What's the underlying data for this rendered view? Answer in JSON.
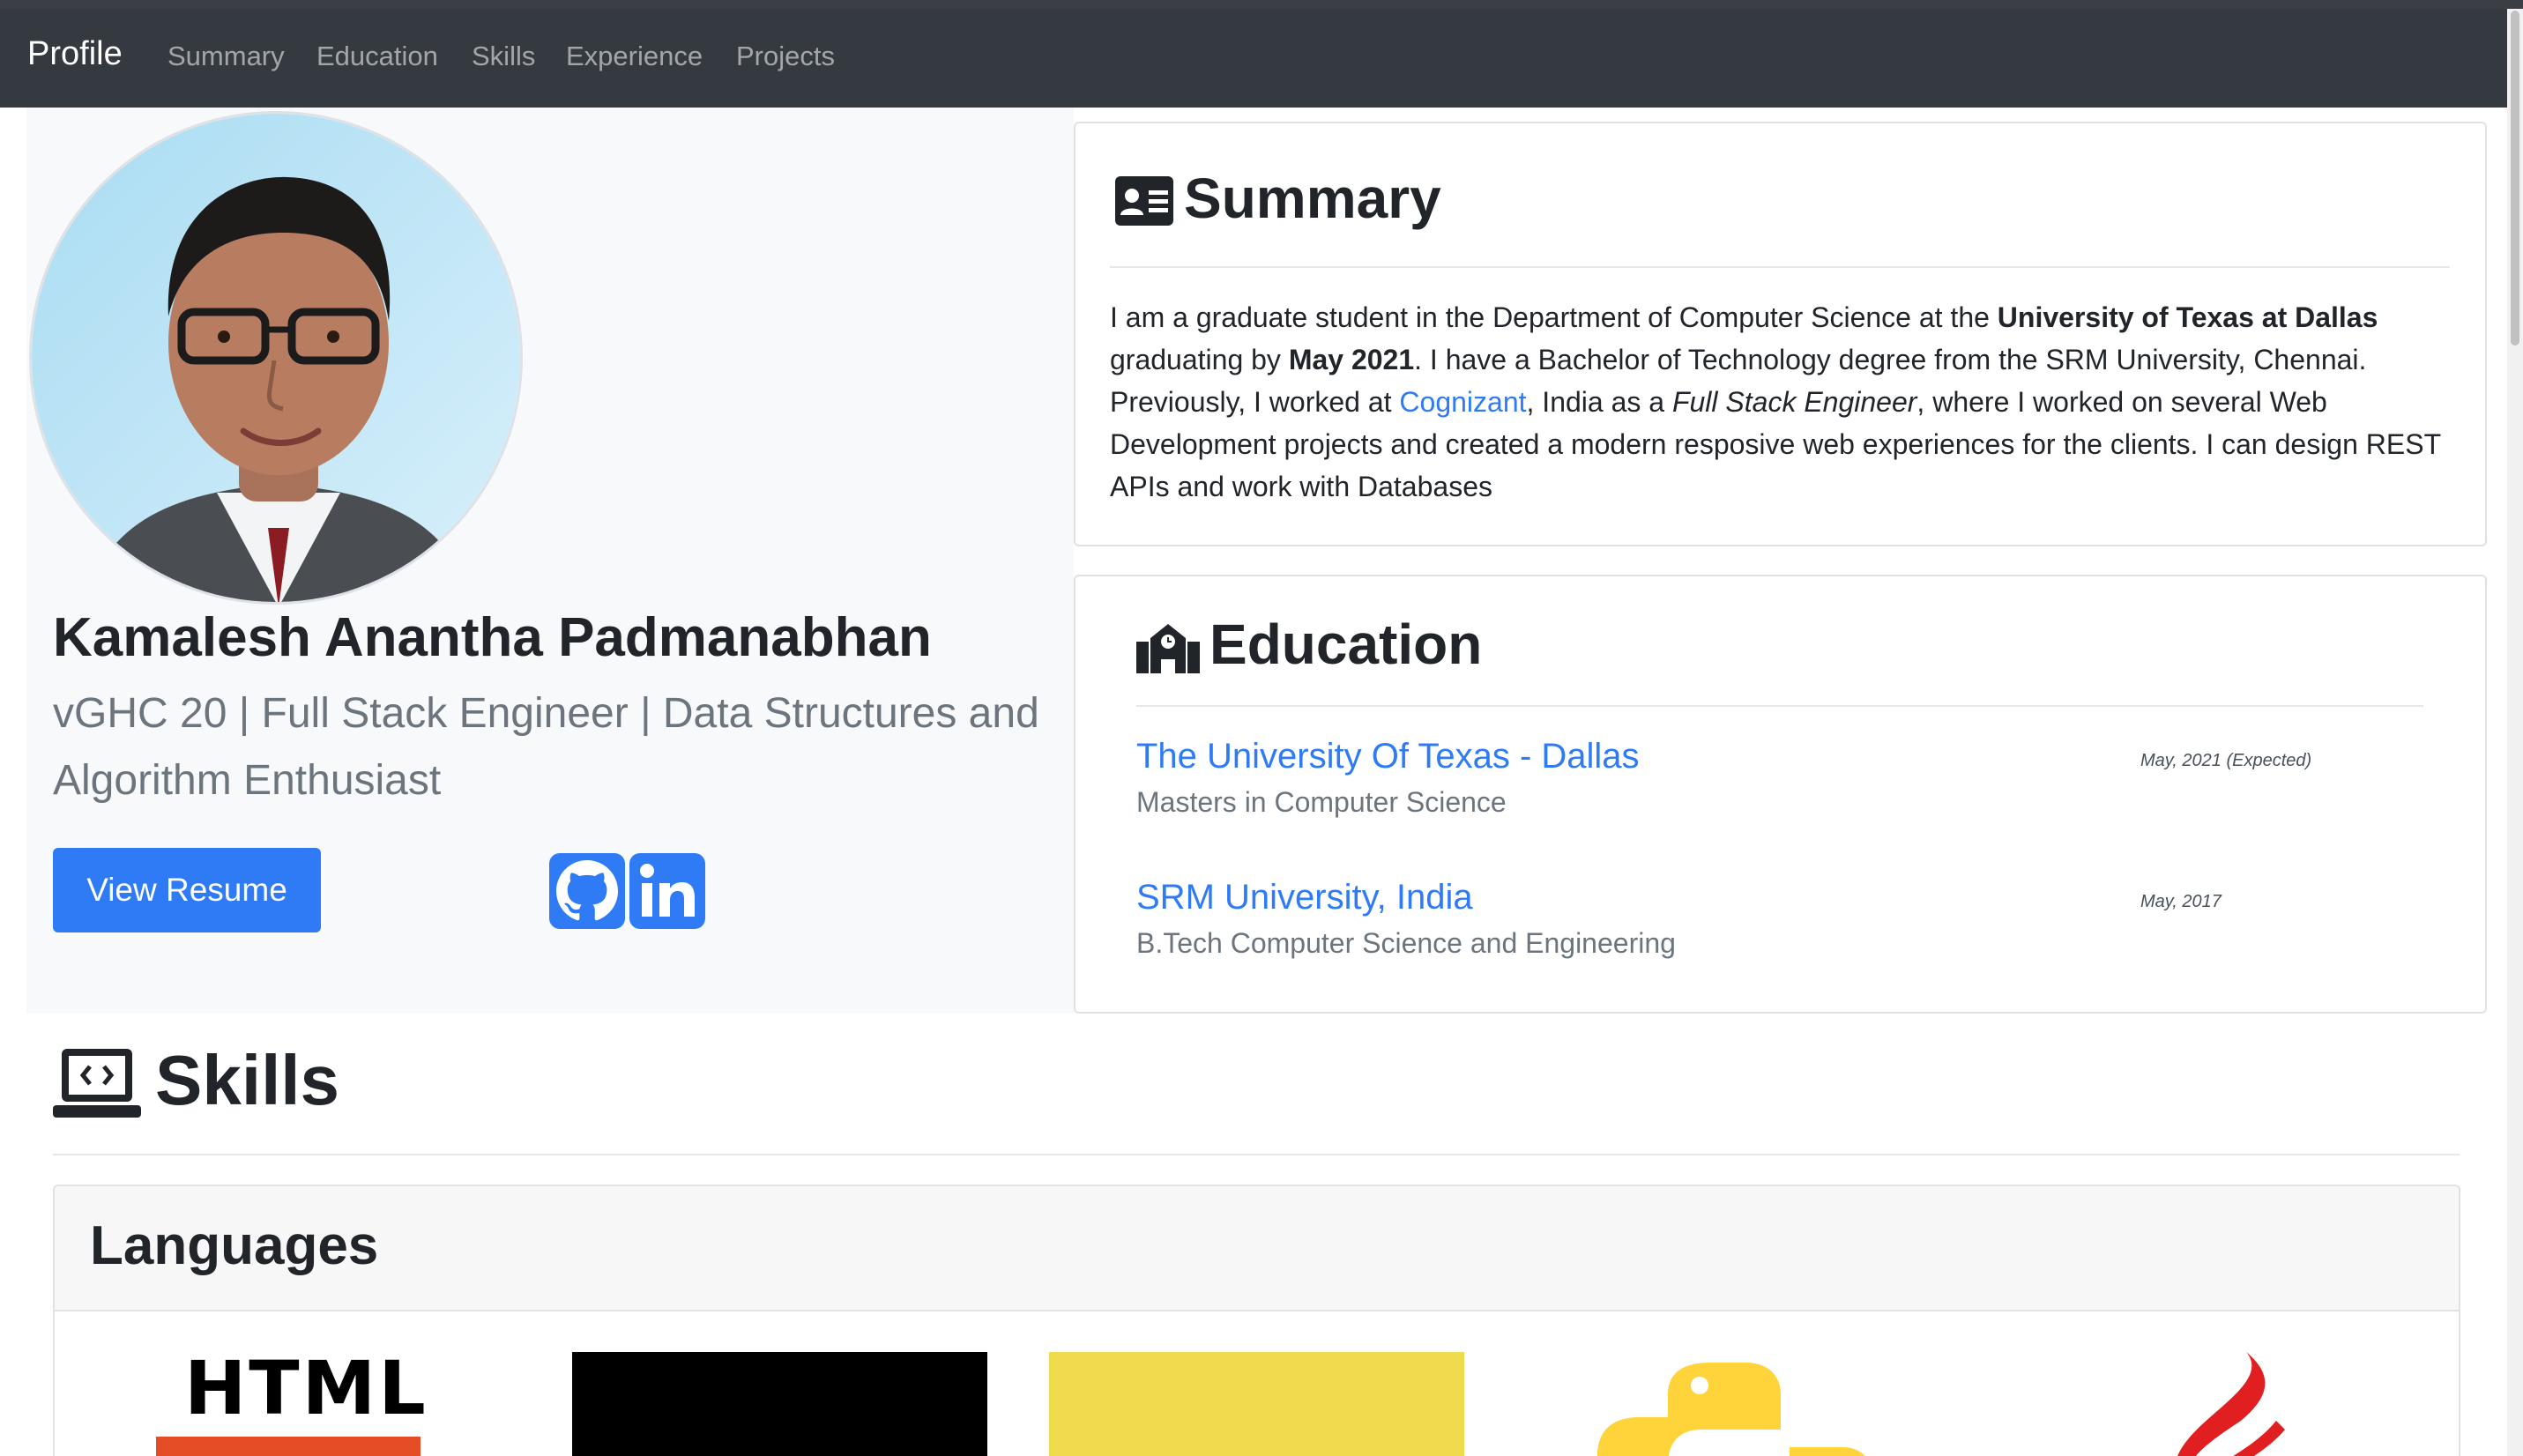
{
  "navbar": {
    "brand": "Profile",
    "links": [
      "Summary",
      "Education",
      "Skills",
      "Experience",
      "Projects"
    ]
  },
  "profile": {
    "name": "Kamalesh Anantha Padmanabhan",
    "tagline": "vGHC 20 | Full Stack Engineer | Data Structures and Algorithm Enthusiast",
    "resume_button": "View Resume",
    "social_icons": [
      "github-icon",
      "linkedin-icon"
    ]
  },
  "summary": {
    "title": "Summary",
    "t1": "I am a graduate student in the Department of Computer Science at the ",
    "b1": "University of Texas at Dallas",
    "t2": " graduating by ",
    "b2": "May 2021",
    "t3": ". I have a Bachelor of Technology degree from the SRM University, Chennai. Previously, I worked at ",
    "link": "Cognizant",
    "t4": ", India as a ",
    "i1": "Full Stack Engineer",
    "t5": ", where I worked on several Web Development projects and created a modern resposive web experiences for the clients. I can design REST APIs and work with Databases"
  },
  "education": {
    "title": "Education",
    "items": [
      {
        "school": "The University Of Texas - Dallas",
        "degree": "Masters in Computer Science",
        "date": "May, 2021 (Expected)"
      },
      {
        "school": "SRM University, India",
        "degree": "B.Tech Computer Science and Engineering",
        "date": "May, 2017"
      }
    ]
  },
  "skills": {
    "title": "Skills",
    "languages_title": "Languages",
    "logos": [
      "HTML"
    ]
  },
  "colors": {
    "navbar": "#343a40",
    "accent": "#2f7bf5",
    "panel": "#f8f9fa",
    "muted": "#6c757d"
  }
}
